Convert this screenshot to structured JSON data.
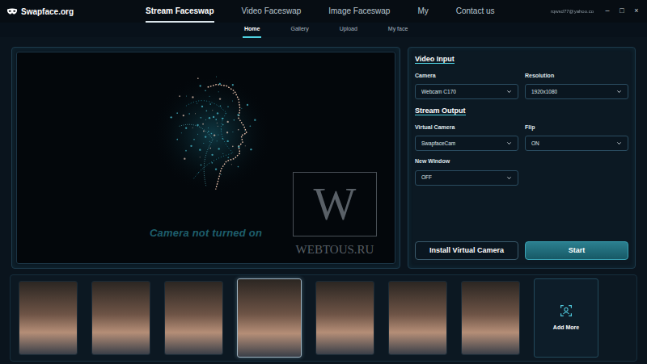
{
  "window": {
    "title": "Swapface.org",
    "account": "rqwsd77@yahoo.co",
    "controls": [
      "–",
      "□",
      "×"
    ]
  },
  "tabs": [
    {
      "label": "Stream Faceswap",
      "selected": true
    },
    {
      "label": "Video Faceswap",
      "selected": false
    },
    {
      "label": "Image Faceswap",
      "selected": false
    },
    {
      "label": "My",
      "selected": false
    },
    {
      "label": "Contact us",
      "selected": false
    }
  ],
  "subtabs": [
    {
      "label": "Home",
      "selected": true
    },
    {
      "label": "Gallery",
      "selected": false
    },
    {
      "label": "Upload",
      "selected": false
    },
    {
      "label": "My face",
      "selected": false
    }
  ],
  "preview": {
    "status": "Camera not turned on"
  },
  "watermark": {
    "letter": "W",
    "site": "WEBTOUS.RU"
  },
  "video_input": {
    "title": "Video Input",
    "fields": [
      {
        "label": "Camera",
        "value": "Webcam C170"
      },
      {
        "label": "Resolution",
        "value": "1920x1080"
      }
    ]
  },
  "stream_output": {
    "title": "Stream Output",
    "fields": [
      {
        "label": "Virtual Camera",
        "value": "SwapfaceCam"
      },
      {
        "label": "Flip",
        "value": "ON"
      },
      {
        "label": "New Window",
        "value": "OFF"
      }
    ]
  },
  "buttons": [
    {
      "label": "Install Virtual Camera",
      "kind": "outline"
    },
    {
      "label": "Start",
      "kind": "primary"
    }
  ],
  "faces": [
    {
      "selected": false
    },
    {
      "selected": false
    },
    {
      "selected": false
    },
    {
      "selected": true
    },
    {
      "selected": false
    },
    {
      "selected": false
    },
    {
      "selected": false
    }
  ],
  "add_more": {
    "label": "Add More"
  }
}
